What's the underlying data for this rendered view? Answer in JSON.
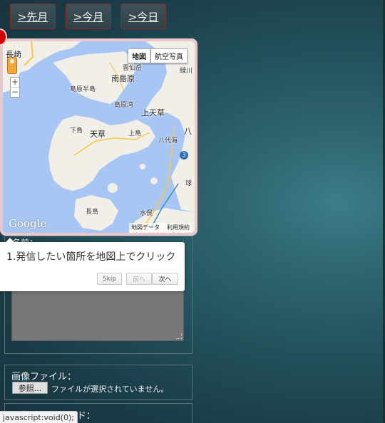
{
  "nav": {
    "prev_month": ">先月",
    "this_month": ">今月",
    "today": ">今日"
  },
  "map": {
    "type_map": "地図",
    "type_satellite": "航空写真",
    "zoom_in": "+",
    "zoom_out": "−",
    "google_logo": "Google",
    "map_data": "地図データ",
    "terms": "利用規約",
    "places": {
      "nagasaki": "長崎",
      "unzen": "雲仙岳",
      "minamishimabara": "南島原",
      "shimabara_peninsula": "島原半島",
      "shimabara_bay": "島原湾",
      "kamiamakusa": "上天草",
      "midorikawa": "緑川",
      "shimoshima": "下島",
      "amakusa": "天草",
      "kamishima": "上島",
      "yatsushiro_sea": "八代海",
      "yatsu": "八",
      "route": "3",
      "kyu": "球",
      "nagashima": "長島",
      "minamata": "水俣"
    }
  },
  "form": {
    "name_label": "名前：",
    "file_label": "画像ファイル：",
    "browse_button": "参照...",
    "no_file": "ファイルが選択されていません。",
    "next_label_partial": "※削除パスワード："
  },
  "tour": {
    "message": "1.発信したい箇所を地図上でクリック",
    "skip": "Skip",
    "prev": "前へ",
    "next": "次へ"
  },
  "status_bar": {
    "url": "javascript:void(0);"
  }
}
